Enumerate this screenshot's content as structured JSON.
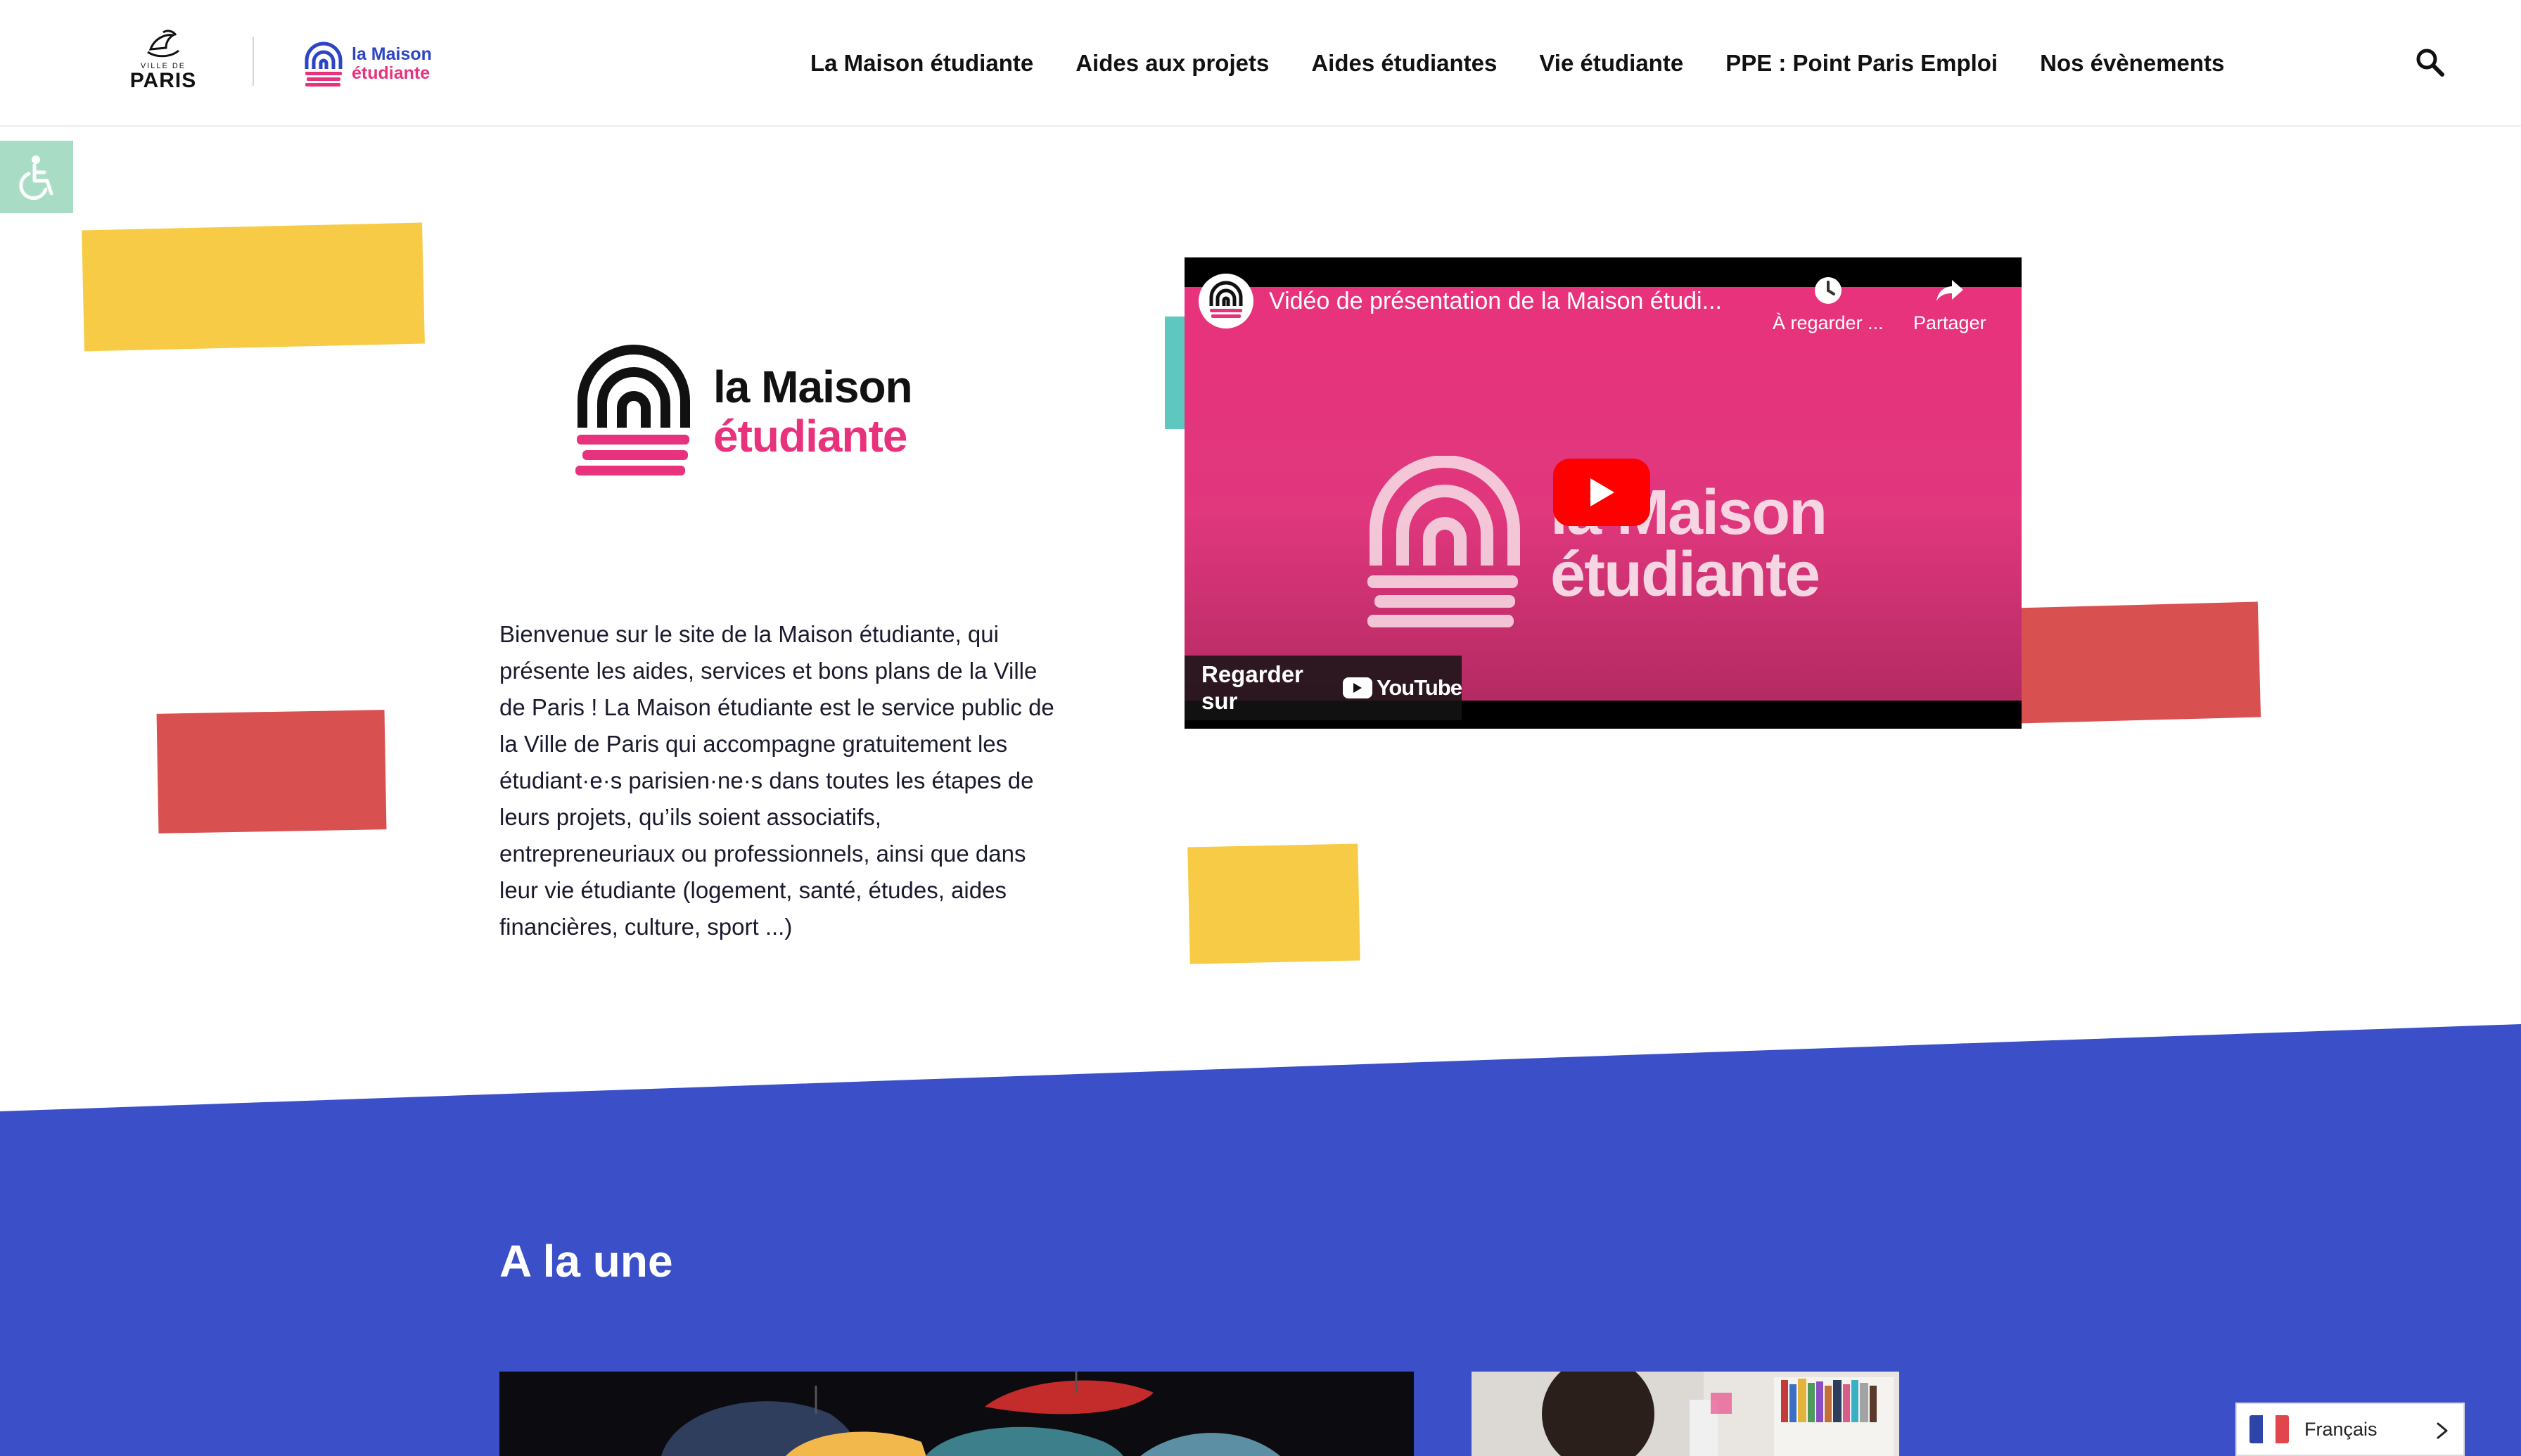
{
  "header": {
    "city_logo": {
      "top": "VILLE DE",
      "name": "PARIS"
    },
    "brand_logo": {
      "line1": "la Maison",
      "line2": "étudiante"
    },
    "nav": [
      {
        "label": "La Maison étudiante"
      },
      {
        "label": "Aides aux projets"
      },
      {
        "label": "Aides étudiantes"
      },
      {
        "label": "Vie étudiante"
      },
      {
        "label": "PPE : Point Paris Emploi"
      },
      {
        "label": "Nos évènements"
      }
    ],
    "search_icon": "search-icon"
  },
  "accessibility": {
    "icon": "wheelchair-icon"
  },
  "hero": {
    "logo": {
      "line1": "la Maison",
      "line2": "étudiante"
    },
    "intro": "Bienvenue sur le site de la Maison étudiante, qui présente les aides, services et bons plans de la Ville de Paris ! La Maison étudiante est le service public de la Ville de Paris qui accompagne gratuitement les étudiant·e·s parisien·ne·s dans toutes les étapes de leurs projets, qu’ils soient associatifs, entrepreneuriaux ou professionnels, ainsi que dans leur vie étudiante (logement, santé, études, aides financières, culture, sport ...)"
  },
  "video": {
    "title": "Vidéo de présentation de la Maison étudi...",
    "watch_later": "À regarder ...",
    "share": "Partager",
    "watch_on": "Regarder sur",
    "youtube": "YouTube",
    "overlay_logo": {
      "line1": "la Maison",
      "line2": "étudiante"
    }
  },
  "news": {
    "title": "A la une"
  },
  "language": {
    "label": "Français"
  },
  "colors": {
    "brand_blue": "#3a4fc8",
    "brand_pink": "#e8327c",
    "yellow": "#f7cb45",
    "red": "#d85050",
    "teal": "#5ec8c0",
    "a11y_green": "#a8dcc5"
  }
}
